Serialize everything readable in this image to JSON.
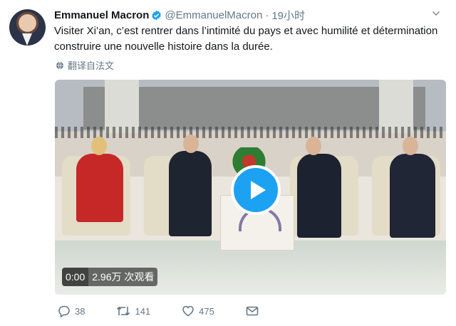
{
  "tweet": {
    "author_name": "Emmanuel Macron",
    "handle": "@EmmanuelMacron",
    "separator": "·",
    "time": "19小时",
    "text": "Visiter Xi’an, c’est rentrer dans l’intimité du pays et avec humilité et détermination construire une nouvelle histoire dans la durée.",
    "translate_label": "翻译自法文"
  },
  "video": {
    "duration": "0:00",
    "views": "2.96万 次观看"
  },
  "actions": {
    "reply_count": "38",
    "retweet_count": "141",
    "like_count": "475"
  },
  "colors": {
    "accent": "#1da1f2",
    "muted": "#657786",
    "text": "#14171a"
  }
}
